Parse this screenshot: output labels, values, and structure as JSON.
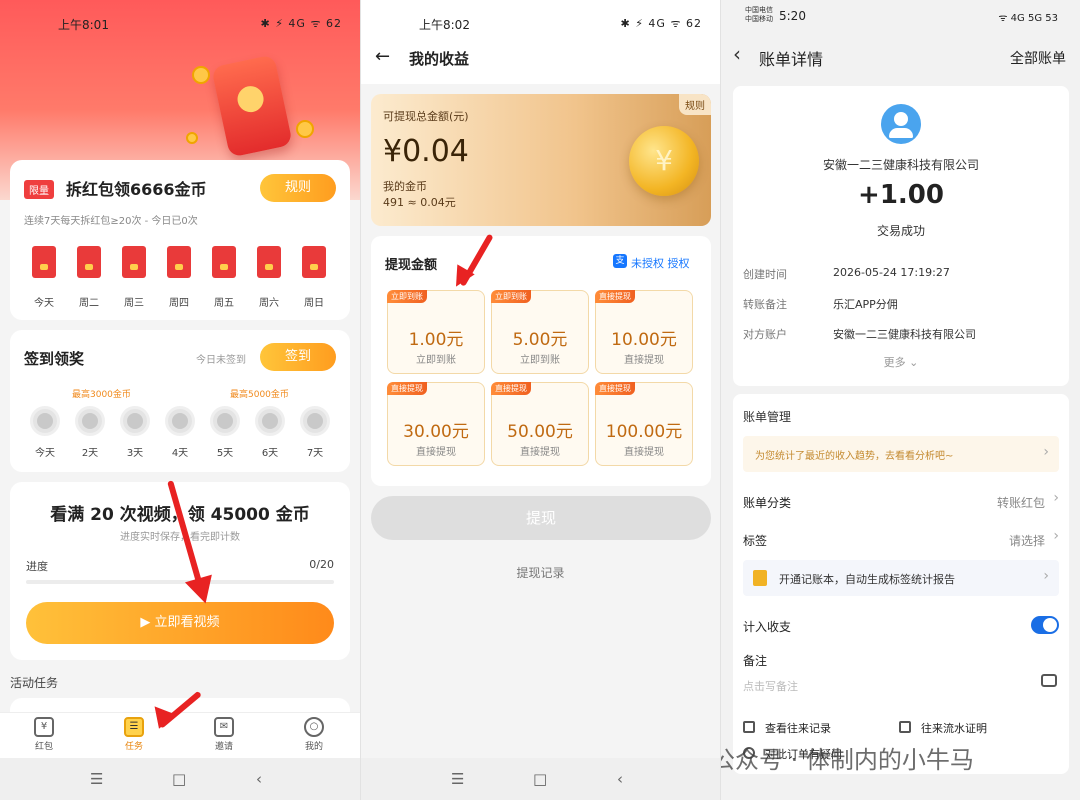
{
  "p1": {
    "status_time": "上午8:01",
    "status_right": "✱ ⚡ 4G ᯤ 62",
    "promo": {
      "tag": "限量",
      "title": "拆红包领6666金币",
      "rules": "规则",
      "subtitle": "连续7天每天拆红包≥20次 - 今日已0次",
      "days": [
        "今天",
        "周二",
        "周三",
        "周四",
        "周五",
        "周六",
        "周日"
      ]
    },
    "signin": {
      "title": "签到领奖",
      "status": "今日未签到",
      "button": "签到",
      "max1": "最高3000金币",
      "max2": "最高5000金币",
      "days": [
        "今天",
        "2天",
        "3天",
        "4天",
        "5天",
        "6天",
        "7天"
      ]
    },
    "video": {
      "title": "看满 20 次视频，领 45000 金币",
      "subtitle": "进度实时保存，看完即计数",
      "progress_label": "进度",
      "progress_text": "0/20",
      "progress_fraction": 0,
      "button": "▶  立即看视频"
    },
    "activity_label": "活动任务",
    "tabs": [
      {
        "label": "红包",
        "icon": "¥"
      },
      {
        "label": "任务",
        "icon": "☰"
      },
      {
        "label": "邀请",
        "icon": "✉"
      },
      {
        "label": "我的",
        "icon": "○"
      }
    ],
    "sysnav": [
      "☰",
      "□",
      "‹"
    ]
  },
  "p2": {
    "status_time": "上午8:02",
    "status_right": "✱ ⚡ 4G ᯤ 62",
    "header_title": "我的收益",
    "back": "←",
    "rules": "规则",
    "withdrawable_label": "可提现总金额(元)",
    "withdrawable_amount": "¥0.04",
    "coins_label": "我的金币",
    "coins_value": "491 ≈ 0.04元",
    "withdraw_title": "提现金额",
    "auth_text": "未授权 授权",
    "auth_icon": "支",
    "options": [
      {
        "badge": "立即到账",
        "value": "1.00元",
        "sub": "立即到账"
      },
      {
        "badge": "立即到账",
        "value": "5.00元",
        "sub": "立即到账"
      },
      {
        "badge": "直接提现",
        "value": "10.00元",
        "sub": "直接提现"
      },
      {
        "badge": "直接提现",
        "value": "30.00元",
        "sub": "直接提现"
      },
      {
        "badge": "直接提现",
        "value": "50.00元",
        "sub": "直接提现"
      },
      {
        "badge": "直接提现",
        "value": "100.00元",
        "sub": "直接提现"
      }
    ],
    "withdraw_button": "提现",
    "records_link": "提现记录",
    "sysnav": [
      "☰",
      "□",
      "‹"
    ]
  },
  "p3": {
    "carrier": "中国电信\n中国移动",
    "status_time": "5:20",
    "status_right": "ᯤ 4G 5G 53",
    "header_title": "账单详情",
    "all_bills": "全部账单",
    "company": "安徽一二三健康科技有限公司",
    "amount": "+1.00",
    "state": "交易成功",
    "details": [
      {
        "k": "创建时间",
        "v": "2026-05-24 17:19:27"
      },
      {
        "k": "转账备注",
        "v": "乐汇APP分佣"
      },
      {
        "k": "对方账户",
        "v": "安徽一二三健康科技有限公司"
      }
    ],
    "more": "更多 ⌄",
    "bill_mgmt": "账单管理",
    "trend_tip": "为您统计了最近的收入趋势，去看看分析吧~",
    "category_label": "账单分类",
    "category_value": "转账红包",
    "tag_label": "标签",
    "tag_value": "请选择",
    "notebook_tip": "开通记账本，自动生成标签统计报告",
    "income_label": "计入收支",
    "note_label": "备注",
    "note_placeholder": "点击写备注",
    "link1": "查看往来记录",
    "link2": "往来流水证明",
    "question": "对此订单有疑问",
    "watermark": "公众号 · 体制内的小牛马"
  }
}
